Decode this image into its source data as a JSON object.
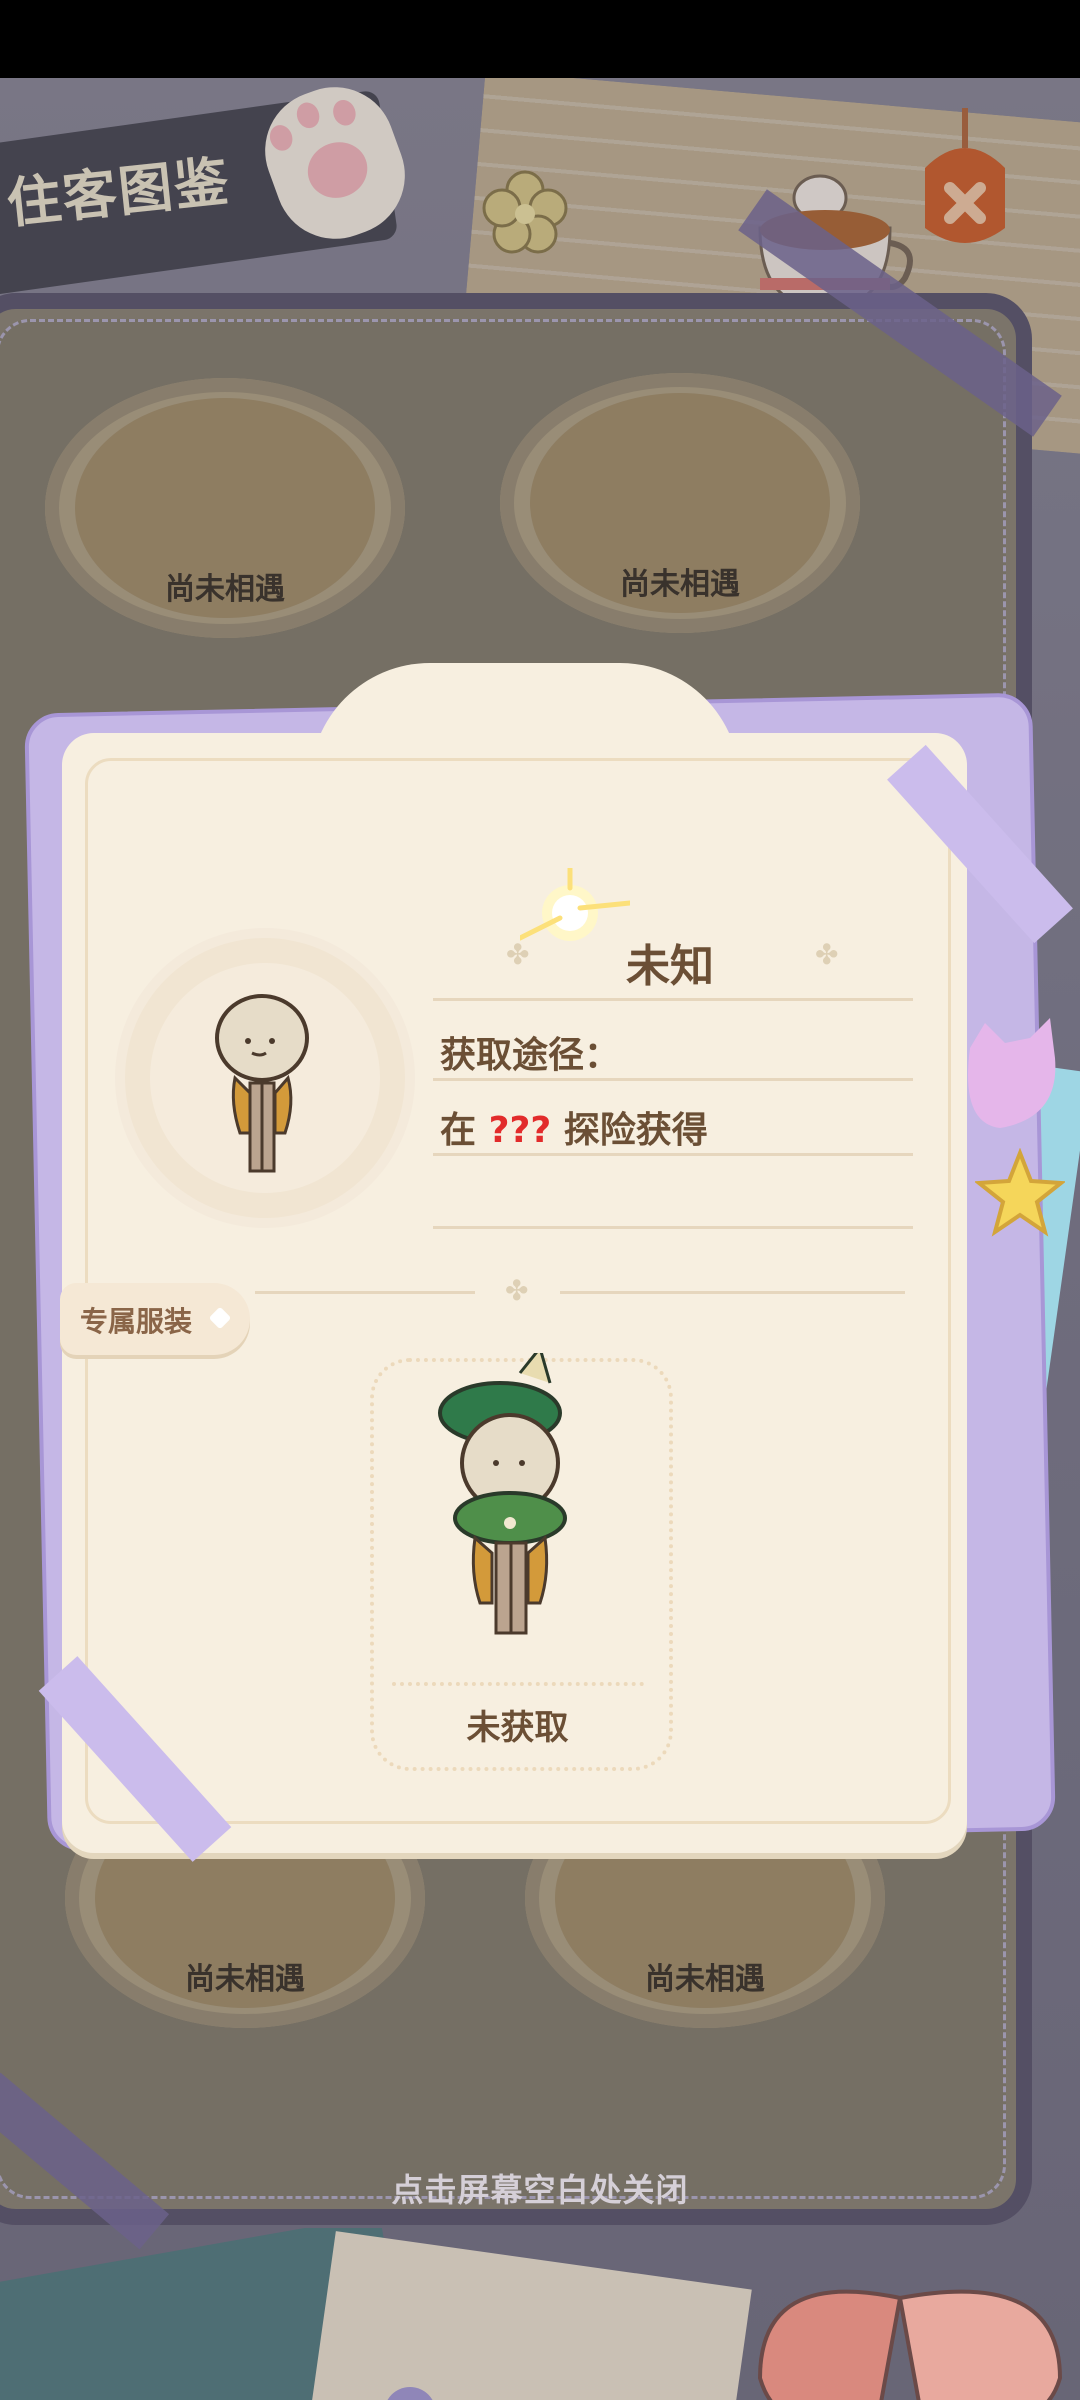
{
  "header": {
    "title": "住客图鉴"
  },
  "grid": {
    "slots": [
      {
        "status": "尚未相遇"
      },
      {
        "status": "尚未相遇"
      },
      {
        "status": "尚未相遇"
      },
      {
        "status": "尚未相遇"
      }
    ]
  },
  "detail_card": {
    "name": "未知",
    "source_label": "获取途径：",
    "source_prefix": "在",
    "source_location": "???",
    "source_suffix": "探险获得",
    "outfit_tag": "专属服装",
    "outfit_status": "未获取"
  },
  "close_hint": "点击屏幕空白处关闭",
  "colors": {
    "title_text": "#6b4f35",
    "unknown_location": "#e22b2b",
    "card_background": "#f7efe0",
    "ribbon_lavender": "#cbbcec"
  },
  "icons": [
    "paw-icon",
    "flower-icon",
    "teacup-icon",
    "hang-tag-icon",
    "sparkle-icon",
    "clover-icon",
    "star-icon",
    "butterfly-icon"
  ]
}
